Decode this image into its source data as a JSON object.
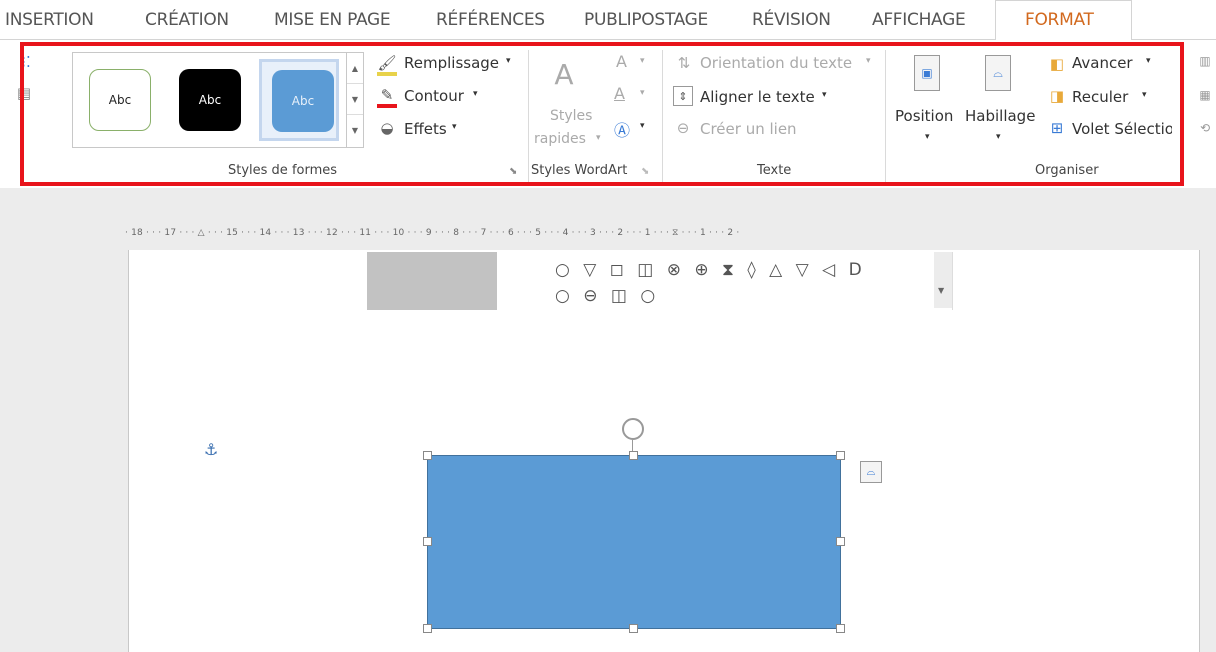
{
  "tabs": [
    "INSERTION",
    "CRÉATION",
    "MISE EN PAGE",
    "RÉFÉRENCES",
    "PUBLIPOSTAGE",
    "RÉVISION",
    "AFFICHAGE",
    "FORMAT"
  ],
  "styles": {
    "swatches": [
      "Abc",
      "Abc",
      "Abc"
    ],
    "fill_label": "Remplissage",
    "outline_label": "Contour",
    "effects_label": "Effets",
    "group_label": "Styles de formes"
  },
  "wordart": {
    "quick_styles_line1": "Styles",
    "quick_styles_line2": "rapides",
    "group_label": "Styles WordArt",
    "letter": "A"
  },
  "text_group": {
    "orientation_label": "Orientation du texte",
    "align_label": "Aligner le texte",
    "link_label": "Créer un lien",
    "group_label": "Texte"
  },
  "arrange": {
    "position_label": "Position",
    "wrap_label": "Habillage",
    "forward_label": "Avancer",
    "backward_label": "Reculer",
    "selection_label": "Volet Sélection",
    "group_label": "Organiser"
  },
  "ruler_text": "· 18 · · · 17 · · · △ · · · 15 · · · 14 · · · 13 · · · 12 · · · 11 · · · 10 · · · 9 · · · 8 · · · 7 · · · 6 · · · 5 · · · 4 · · · 3 · · · 2 · · · 1 · · · ⧖ · · · 1 · · · 2 ·",
  "shapes": {
    "row1": "○ ▽ ◻ ◫ ⊗ ⊕ ⧗ ◊ △ ▽ ◁ D",
    "row2": "○ ⊖ ◫ ○"
  },
  "anchor_glyph": "⚓",
  "colors": {
    "accent": "#d2691e",
    "shape_fill": "#5b9bd5",
    "highlight": "#e8141b"
  }
}
